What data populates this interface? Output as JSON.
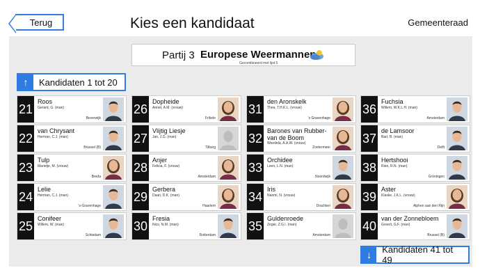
{
  "header": {
    "back_label": "Terug",
    "title": "Kies een kandidaat",
    "council": "Gemeenteraad"
  },
  "party": {
    "number": "Partij 3",
    "name": "Europese Weermannen",
    "subtitle": "Gecombineerd met lijst 5"
  },
  "nav": {
    "up_label": "Kandidaten 1 tot 20",
    "down_label": "Kandidaten 41 tot 49"
  },
  "candidates": [
    {
      "num": "21",
      "name": "Roos",
      "info": "Gerard, G. (man)",
      "city": "Beverwijk",
      "photo": "male-photo-1"
    },
    {
      "num": "22",
      "name": "van Chrysant",
      "info": "Herman, C.J. (man)",
      "city": "Brussel (B)",
      "photo": "male-photo-2"
    },
    {
      "num": "23",
      "name": "Tulp",
      "info": "Marietje, M. (vrouw)",
      "city": "Breda",
      "photo": "female-photo-1"
    },
    {
      "num": "24",
      "name": "Lelie",
      "info": "Herman, C.J. (man)",
      "city": "'s-Gravenhage",
      "photo": "male-photo-3"
    },
    {
      "num": "25",
      "name": "Conifeer",
      "info": "Willem, W. (man)",
      "city": "Schiedam",
      "photo": "male-photo-4"
    },
    {
      "num": "26",
      "name": "Dopheide",
      "info": "Annet, A.M. (vrouw)",
      "city": "Frikele",
      "photo": "female-photo-2"
    },
    {
      "num": "27",
      "name": "Vlijtig Liesje",
      "info": "Jan, J.G. (man)",
      "city": "Tilburg",
      "photo": "placeholder-photo"
    },
    {
      "num": "28",
      "name": "Anjer",
      "info": "Felicia, F. (vrouw)",
      "city": "Amsterdam",
      "photo": "female-photo-3"
    },
    {
      "num": "29",
      "name": "Gerbera",
      "info": "Daan, D.K. (man)",
      "city": "Haarlem",
      "photo": "female-photo-4"
    },
    {
      "num": "30",
      "name": "Fresia",
      "info": "Nico, N.M. (man)",
      "city": "Rotterdam",
      "photo": "male-photo-5"
    },
    {
      "num": "31",
      "name": "den Aronskelk",
      "info": "Thea, T.H.K.L. (vrouw)",
      "city": "'s Gravenhage",
      "photo": "female-photo-5"
    },
    {
      "num": "32",
      "name": "Barones van Rubber-van de Boom",
      "info": "Wendela, A.A.W. (vrouw)",
      "city": "Zoetermeer",
      "photo": "female-photo-6"
    },
    {
      "num": "33",
      "name": "Orchidee",
      "info": "Leen, L.N. (man)",
      "city": "Noordwijk",
      "photo": "male-photo-6"
    },
    {
      "num": "34",
      "name": "Iris",
      "info": "Naomi, N. (vrouw)",
      "city": "Drachten",
      "photo": "female-photo-7"
    },
    {
      "num": "35",
      "name": "Guldenroede",
      "info": "Zeger, Z.G.I. (man)",
      "city": "Amsterdam",
      "photo": "placeholder-photo"
    },
    {
      "num": "36",
      "name": "Fuchsia",
      "info": "Willem, W.K.L.H. (man)",
      "city": "Amsterdam",
      "photo": "male-photo-7"
    },
    {
      "num": "37",
      "name": "de Lamsoor",
      "info": "Bart, B. (man)",
      "city": "Delft",
      "photo": "male-photo-8"
    },
    {
      "num": "38",
      "name": "Hertshooi",
      "info": "Rien, R.N. (man)",
      "city": "Groningen",
      "photo": "male-photo-9"
    },
    {
      "num": "39",
      "name": "Aster",
      "info": "Klaske, J.K.L. (vrouw)",
      "city": "Alphen aan den Rijn",
      "photo": "female-photo-8"
    },
    {
      "num": "40",
      "name": "van der Zonnebloem",
      "info": "Govert, G.F. (man)",
      "city": "Brussel (B)",
      "photo": "male-photo-10"
    }
  ],
  "colors": {
    "accent": "#2f7de1",
    "number_bg": "#111111",
    "panel_bg": "#ebebeb"
  }
}
